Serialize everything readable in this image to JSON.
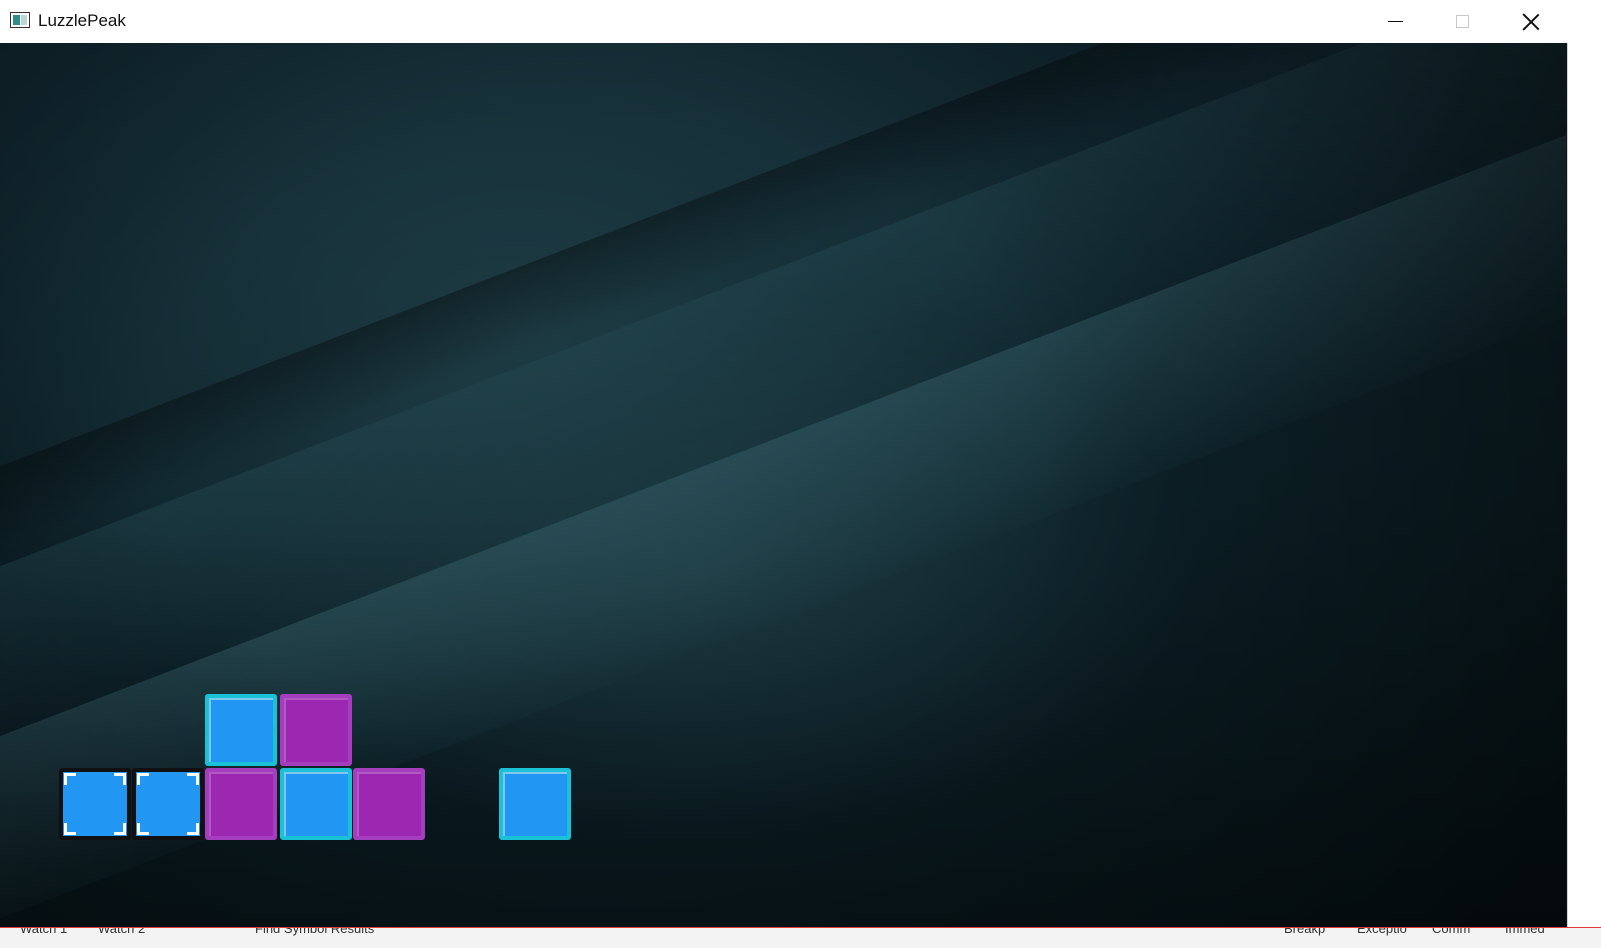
{
  "window": {
    "title": "LuzzlePeak",
    "controls": {
      "minimize": "minimize",
      "maximize": "maximize",
      "close": "close"
    }
  },
  "game": {
    "blocks": [
      {
        "color": "blue",
        "selected": true
      },
      {
        "color": "blue",
        "selected": true
      },
      {
        "color": "blue",
        "selected": false
      },
      {
        "color": "purple",
        "selected": false
      },
      {
        "color": "purple",
        "selected": false
      },
      {
        "color": "blue",
        "selected": false
      },
      {
        "color": "purple",
        "selected": false
      },
      {
        "color": "blue",
        "selected": false
      }
    ],
    "colors": {
      "blue": "#2196f3",
      "blue_border": "#19c2d6",
      "purple": "#9c27b0",
      "selection": "#111111"
    }
  },
  "background_app": {
    "items": [
      "Watch 1",
      "Watch 2",
      "Find Symbol Results",
      "Breakp",
      "Exceptio",
      "Comm",
      "Immed"
    ]
  }
}
